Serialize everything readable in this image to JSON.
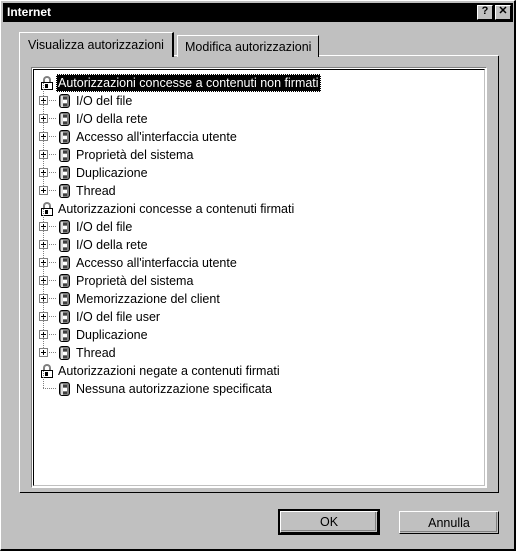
{
  "window": {
    "title": "Internet",
    "help_button": "?",
    "close_button": "✕"
  },
  "tabs": [
    {
      "label": "Visualizza autorizzazioni",
      "active": true
    },
    {
      "label": "Modifica autorizzazioni",
      "active": false
    }
  ],
  "tree": {
    "nodes": [
      {
        "label": "Autorizzazioni concesse a contenuti non firmati",
        "level": "root",
        "icon": "padlock-icon",
        "selected": true,
        "expander": "none"
      },
      {
        "label": "I/O del file",
        "level": "child",
        "icon": "permission-icon",
        "selected": false,
        "expander": "plus"
      },
      {
        "label": "I/O della rete",
        "level": "child",
        "icon": "permission-icon",
        "selected": false,
        "expander": "plus"
      },
      {
        "label": "Accesso all'interfaccia utente",
        "level": "child",
        "icon": "permission-icon",
        "selected": false,
        "expander": "plus"
      },
      {
        "label": "Proprietà del sistema",
        "level": "child",
        "icon": "permission-icon",
        "selected": false,
        "expander": "plus"
      },
      {
        "label": "Duplicazione",
        "level": "child",
        "icon": "permission-icon",
        "selected": false,
        "expander": "plus"
      },
      {
        "label": "Thread",
        "level": "child",
        "icon": "permission-icon",
        "selected": false,
        "expander": "plus"
      },
      {
        "label": "Autorizzazioni concesse a contenuti firmati",
        "level": "root",
        "icon": "padlock-icon",
        "selected": false,
        "expander": "none"
      },
      {
        "label": "I/O del file",
        "level": "child",
        "icon": "permission-icon",
        "selected": false,
        "expander": "plus"
      },
      {
        "label": "I/O della rete",
        "level": "child",
        "icon": "permission-icon",
        "selected": false,
        "expander": "plus"
      },
      {
        "label": "Accesso all'interfaccia utente",
        "level": "child",
        "icon": "permission-icon",
        "selected": false,
        "expander": "plus"
      },
      {
        "label": "Proprietà del sistema",
        "level": "child",
        "icon": "permission-icon",
        "selected": false,
        "expander": "plus"
      },
      {
        "label": "Memorizzazione del client",
        "level": "child",
        "icon": "permission-icon",
        "selected": false,
        "expander": "plus"
      },
      {
        "label": "I/O del file user",
        "level": "child",
        "icon": "permission-icon",
        "selected": false,
        "expander": "plus"
      },
      {
        "label": "Duplicazione",
        "level": "child",
        "icon": "permission-icon",
        "selected": false,
        "expander": "plus"
      },
      {
        "label": "Thread",
        "level": "child",
        "icon": "permission-icon",
        "selected": false,
        "expander": "plus"
      },
      {
        "label": "Autorizzazioni negate a contenuti firmati",
        "level": "root",
        "icon": "padlock-icon",
        "selected": false,
        "expander": "none"
      },
      {
        "label": "Nessuna autorizzazione specificata",
        "level": "child",
        "icon": "permission-icon",
        "selected": false,
        "expander": "leaf"
      }
    ]
  },
  "buttons": {
    "ok": "OK",
    "cancel": "Annulla"
  },
  "colors": {
    "face": "#c0c0c0",
    "titlebar": "#000000",
    "titlebar_text": "#ffffff",
    "selection": "#000000",
    "selection_text": "#ffffff",
    "tree_background": "#ffffff"
  }
}
